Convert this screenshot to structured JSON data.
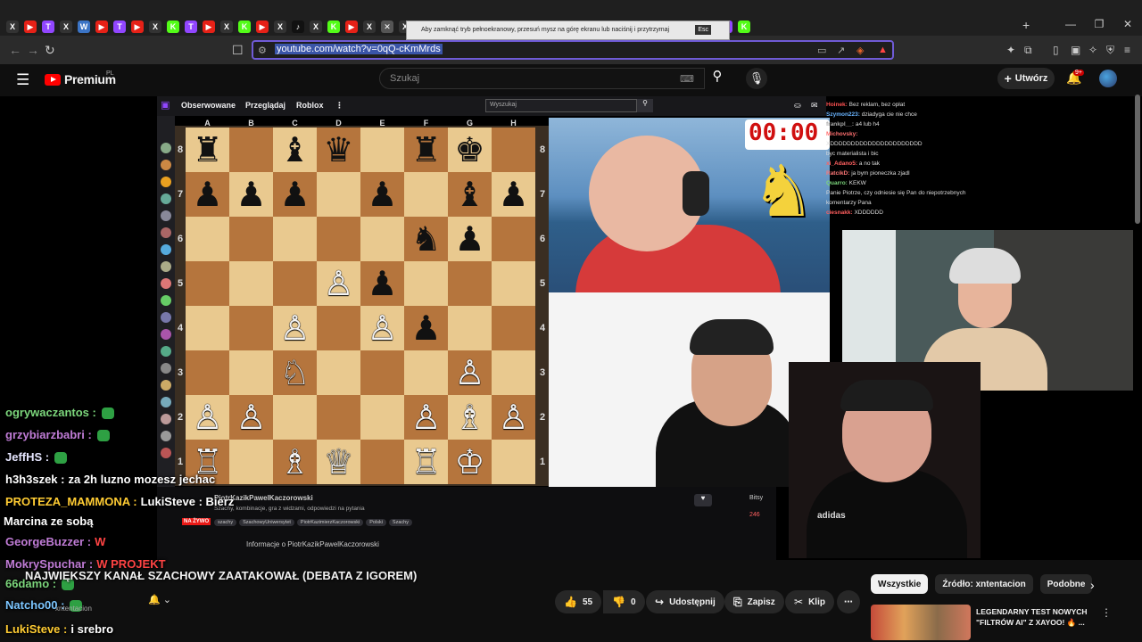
{
  "browser": {
    "url": "youtube.com/watch?v=0qQ-cKmMrds",
    "tabs": [
      {
        "icon": "x-icon",
        "color": "#333333",
        "glyph": "X"
      },
      {
        "icon": "youtube-icon",
        "color": "#e62117",
        "glyph": "▶"
      },
      {
        "icon": "twitch-icon",
        "color": "#9146ff",
        "glyph": "T"
      },
      {
        "icon": "x-icon",
        "color": "#333333",
        "glyph": "X"
      },
      {
        "icon": "wykop-icon",
        "color": "#3b74c5",
        "glyph": "W"
      },
      {
        "icon": "youtube-icon",
        "color": "#e62117",
        "glyph": "▶"
      },
      {
        "icon": "twitch-icon",
        "color": "#9146ff",
        "glyph": "T"
      },
      {
        "icon": "youtube-icon",
        "color": "#e62117",
        "glyph": "▶"
      },
      {
        "icon": "x-icon",
        "color": "#333333",
        "glyph": "X"
      },
      {
        "icon": "kick-icon",
        "color": "#53fc18",
        "glyph": "K"
      },
      {
        "icon": "twitch-icon",
        "color": "#9146ff",
        "glyph": "T"
      },
      {
        "icon": "youtube-icon",
        "color": "#e62117",
        "glyph": "▶"
      },
      {
        "icon": "x-icon",
        "color": "#333333",
        "glyph": "X"
      },
      {
        "icon": "kick-icon",
        "color": "#53fc18",
        "glyph": "K"
      },
      {
        "icon": "youtube-icon",
        "color": "#e62117",
        "glyph": "▶"
      },
      {
        "icon": "x-icon",
        "color": "#333333",
        "glyph": "X"
      },
      {
        "icon": "tiktok-icon",
        "color": "#111111",
        "glyph": "♪"
      },
      {
        "icon": "x-icon",
        "color": "#333333",
        "glyph": "X"
      },
      {
        "icon": "kick-icon",
        "color": "#53fc18",
        "glyph": "K"
      },
      {
        "icon": "youtube-icon",
        "color": "#e62117",
        "glyph": "▶"
      },
      {
        "icon": "x-icon",
        "color": "#333333",
        "glyph": "X"
      },
      {
        "icon": "close-icon",
        "color": "#555555",
        "glyph": "✕"
      },
      {
        "icon": "x-icon",
        "color": "#333333",
        "glyph": "X"
      },
      {
        "icon": "youtube-icon",
        "color": "#e62117",
        "glyph": "▶"
      },
      {
        "icon": "kick-icon",
        "color": "#53fc18",
        "glyph": "K"
      },
      {
        "icon": "x-icon",
        "color": "#333333",
        "glyph": "X"
      },
      {
        "icon": "x-icon",
        "color": "#333333",
        "glyph": "X"
      },
      {
        "icon": "x-icon",
        "color": "#333333",
        "glyph": "X"
      },
      {
        "icon": "google-icon",
        "color": "#4285f4",
        "glyph": "G"
      },
      {
        "icon": "x-icon",
        "color": "#333333",
        "glyph": "X"
      },
      {
        "icon": "kick-icon",
        "color": "#53fc18",
        "glyph": "K"
      },
      {
        "icon": "x-icon",
        "color": "#333333",
        "glyph": "X"
      },
      {
        "icon": "google-icon",
        "color": "#4285f4",
        "glyph": "G"
      },
      {
        "icon": "twitch-icon",
        "color": "#9146ff",
        "glyph": "T"
      },
      {
        "icon": "tiktok-icon",
        "color": "#111111",
        "glyph": "♪"
      },
      {
        "icon": "youtube-icon",
        "color": "#e62117",
        "glyph": "▶"
      },
      {
        "icon": "twitch-icon",
        "color": "#9146ff",
        "glyph": "T"
      },
      {
        "icon": "x-icon",
        "color": "#333333",
        "glyph": "X"
      },
      {
        "icon": "youtube-icon",
        "color": "#e62117",
        "glyph": "▶"
      },
      {
        "icon": "kick-icon",
        "color": "#53fc18",
        "glyph": "K"
      },
      {
        "icon": "twitch-icon",
        "color": "#9146ff",
        "glyph": "T"
      },
      {
        "icon": "kick-icon",
        "color": "#53fc18",
        "glyph": "K"
      }
    ],
    "new_tab": "+",
    "window_controls": [
      "—",
      "❐",
      "✕"
    ]
  },
  "youtube": {
    "logo_text": "Premium",
    "logo_region": "PL",
    "search_placeholder": "Szukaj",
    "create_label": "Utwórz",
    "bell_badge": "9+",
    "video_title": "NAJWIĘKSZY KANAŁ SZACHOWY ZAATAKOWAŁ (DEBATA Z IGOREM)",
    "channel_subs": "xntentacion",
    "actions": {
      "like_count": "55",
      "dislike_count": "0",
      "share": "Udostępnij",
      "save": "Zapisz",
      "clip": "Klip"
    },
    "chips": [
      "Wszystkie",
      "Źródło: xntentacion",
      "Podobne"
    ],
    "recommended_title": "LEGENDARNY TEST NOWYCH \"FILTRÓW AI\" Z XAYOO! 🔥 ..."
  },
  "twitch": {
    "nav": [
      "Obserwowane",
      "Przeglądaj",
      "Roblox"
    ],
    "search_placeholder": "Wyszukaj",
    "fullscreen_notice": "Aby zamknąć tryb pełnoekranowy, przesuń mysz na górę ekranu lub naciśnij i przytrzymaj",
    "esc_label": "Esc",
    "timer": "00:00",
    "channel_name": "PiotrKazikPawelKaczorowski",
    "stream_title": "Szachy, kombinacje, gra z widzami, odpowiedzi na pytania",
    "live_label": "NA ŻYWO",
    "tags": [
      "szachy",
      "SzachowyUniwersytet",
      "PiotrKazimierzKaczorowski",
      "Polski",
      "Szachy"
    ],
    "about": "Informacje o PiotrKazikPawelKaczorowski",
    "viewers": "246",
    "bits_label": "Bitsy",
    "chat": [
      {
        "user": "Hoinek",
        "text": "Bez reklam, bez opłat"
      },
      {
        "user": "Szymon223",
        "text": "dziadyga cie nie chce"
      },
      {
        "user": "frankpl__",
        "text": "a4 lub h4"
      },
      {
        "user": "Michovsky",
        "text": ""
      },
      {
        "user": "",
        "text": "XDDDDDDDDDDDDDDDDDDDDDD"
      },
      {
        "user": "",
        "text": "byc materialista i bic"
      },
      {
        "user": "xi_Adano5",
        "text": "a no tak"
      },
      {
        "user": "RatcikD",
        "text": "ja bym pioneczka zjadl"
      },
      {
        "user": "Quarro",
        "text": "KEKW"
      },
      {
        "user": "",
        "text": "Panie Piotrze, czy odniesie się Pan do niepotrzebnych komentarzy Pana"
      },
      {
        "user": "ciesnakk",
        "text": "XDDDDDD"
      }
    ]
  },
  "board": {
    "files": [
      "A",
      "B",
      "C",
      "D",
      "E",
      "F",
      "G",
      "H"
    ],
    "ranks": [
      "8",
      "7",
      "6",
      "5",
      "4",
      "3",
      "2",
      "1"
    ],
    "position": [
      [
        "♜",
        "",
        "♝",
        "♛",
        "",
        "♜",
        "♚",
        ""
      ],
      [
        "♟",
        "♟",
        "♟",
        "",
        "♟",
        "",
        "♝",
        "♟"
      ],
      [
        "",
        "",
        "",
        "",
        "",
        "♞",
        "♟",
        ""
      ],
      [
        "",
        "",
        "",
        "♙",
        "♟",
        "",
        "",
        ""
      ],
      [
        "",
        "",
        "♙",
        "",
        "♙",
        "♟",
        "",
        ""
      ],
      [
        "",
        "",
        "♘",
        "",
        "",
        "",
        "♙",
        ""
      ],
      [
        "♙",
        "♙",
        "",
        "",
        "",
        "♙",
        "♗",
        "♙"
      ],
      [
        "♖",
        "",
        "♗",
        "♕",
        "",
        "♖",
        "♔",
        ""
      ]
    ],
    "white_pieces": [
      "♔",
      "♕",
      "♖",
      "♗",
      "♘",
      "♙"
    ]
  },
  "overlay_chat": [
    {
      "user": "ogrywaczantos",
      "color": "#7cd67c",
      "text": "",
      "badge": true
    },
    {
      "user": "grzybiarzbabri",
      "color": "#c07cd6",
      "text": "",
      "badge": true
    },
    {
      "user": "JeffHS",
      "color": "#e6e6ff",
      "text": "",
      "badge": true
    },
    {
      "user": "h3h3szek",
      "color": "#ffffff",
      "text": "za 2h luzno mozesz jechac",
      "badge": false
    },
    {
      "user": "PROTEZA_MAMMONA",
      "color": "#ffcc33",
      "text": "LukiSteve : Bierz",
      "badge": false
    },
    {
      "user": "",
      "color": "#ffffff",
      "text": "Marcina ze sobą",
      "badge": false
    },
    {
      "user": "GeorgeBuzzer",
      "color": "#c07cd6",
      "text": "W",
      "badge": false
    },
    {
      "user": "MokrySpuchar",
      "color": "#c07cd6",
      "text": "W  PROJEKT",
      "badge": false
    },
    {
      "user": "66damo",
      "color": "#7cd67c",
      "text": "",
      "badge": true
    },
    {
      "user": "Natcho00",
      "color": "#7cc6ff",
      "text": "",
      "badge": true
    },
    {
      "user": "LukiSteve",
      "color": "#ffcc33",
      "text": "i srebro",
      "badge": false
    }
  ],
  "webcam_brand": "adidas"
}
